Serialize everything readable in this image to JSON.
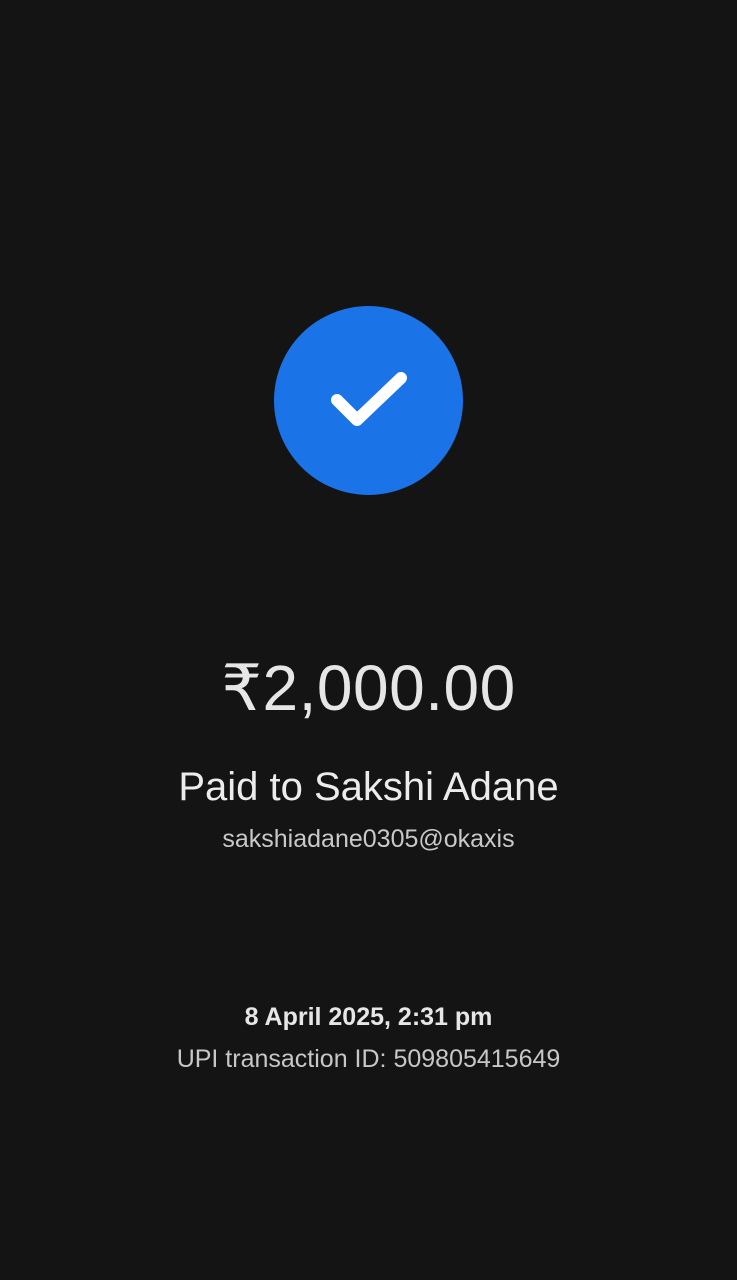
{
  "payment": {
    "status_icon": "check-icon",
    "amount": "₹2,000.00",
    "paid_to": "Paid to Sakshi Adane",
    "upi_id": "sakshiadane0305@okaxis",
    "datetime": "8 April 2025, 2:31 pm",
    "transaction_label": "UPI transaction ID:",
    "transaction_id": "509805415649"
  },
  "colors": {
    "background": "#141414",
    "success_badge": "#1b73e8",
    "check_mark": "#ffffff"
  }
}
